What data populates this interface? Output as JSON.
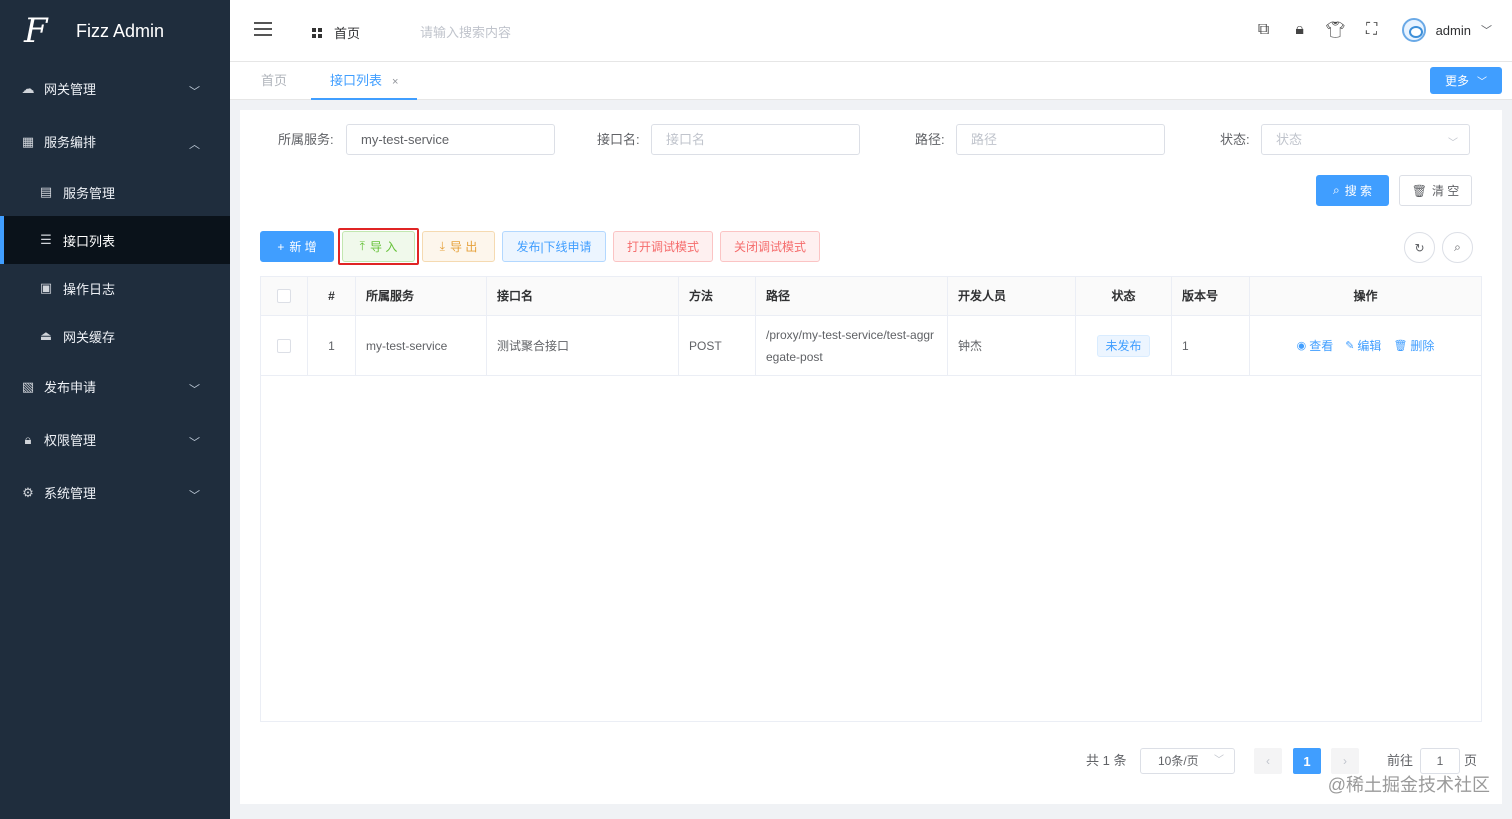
{
  "app": {
    "title": "Fizz Admin"
  },
  "sidebar": {
    "items": [
      {
        "label": "网关管理",
        "icon": "cloud-icon"
      },
      {
        "label": "服务编排",
        "icon": "apps-icon"
      },
      {
        "label": "发布申请",
        "icon": "checklist-icon"
      },
      {
        "label": "权限管理",
        "icon": "lock-icon"
      },
      {
        "label": "系统管理",
        "icon": "gear-icon"
      }
    ],
    "submenu": [
      {
        "label": "服务管理",
        "icon": "service-icon"
      },
      {
        "label": "接口列表",
        "icon": "list-icon",
        "active": true
      },
      {
        "label": "操作日志",
        "icon": "log-icon"
      },
      {
        "label": "网关缓存",
        "icon": "cache-icon"
      }
    ]
  },
  "header": {
    "home_label": "首页",
    "search_placeholder": "请输入搜索内容",
    "username": "admin"
  },
  "tabs": [
    {
      "label": "首页"
    },
    {
      "label": "接口列表",
      "active": true
    }
  ],
  "more_label": "更多",
  "filters": {
    "service_label": "所属服务:",
    "service_value": "my-test-service",
    "name_label": "接口名:",
    "name_placeholder": "接口名",
    "path_label": "路径:",
    "path_placeholder": "路径",
    "status_label": "状态:",
    "status_placeholder": "状态",
    "search_btn": "搜 索",
    "clear_btn": "清 空"
  },
  "toolbar": {
    "add": "新 增",
    "import": "导 入",
    "export": "导 出",
    "publish": "发布|下线申请",
    "debug_on": "打开调试模式",
    "debug_off": "关闭调试模式"
  },
  "table": {
    "headers": [
      "#",
      "所属服务",
      "接口名",
      "方法",
      "路径",
      "开发人员",
      "状态",
      "版本号",
      "操作"
    ],
    "rows": [
      {
        "index": "1",
        "service": "my-test-service",
        "name": "测试聚合接口",
        "method": "POST",
        "path": "/proxy/my-test-service/test-aggregate-post",
        "developer": "钟杰",
        "status": "未发布",
        "version": "1",
        "actions": [
          "查看",
          "编辑",
          "删除"
        ]
      }
    ]
  },
  "pagination": {
    "total": "共 1 条",
    "page_size": "10条/页",
    "current": "1",
    "goto_label": "前往",
    "goto_value": "1",
    "page_suffix": "页"
  },
  "watermark": "@稀土掘金技术社区",
  "colors": {
    "sidebar_bg": "#1f2d3d",
    "primary": "#409eff",
    "highlight_border": "#e02424"
  }
}
